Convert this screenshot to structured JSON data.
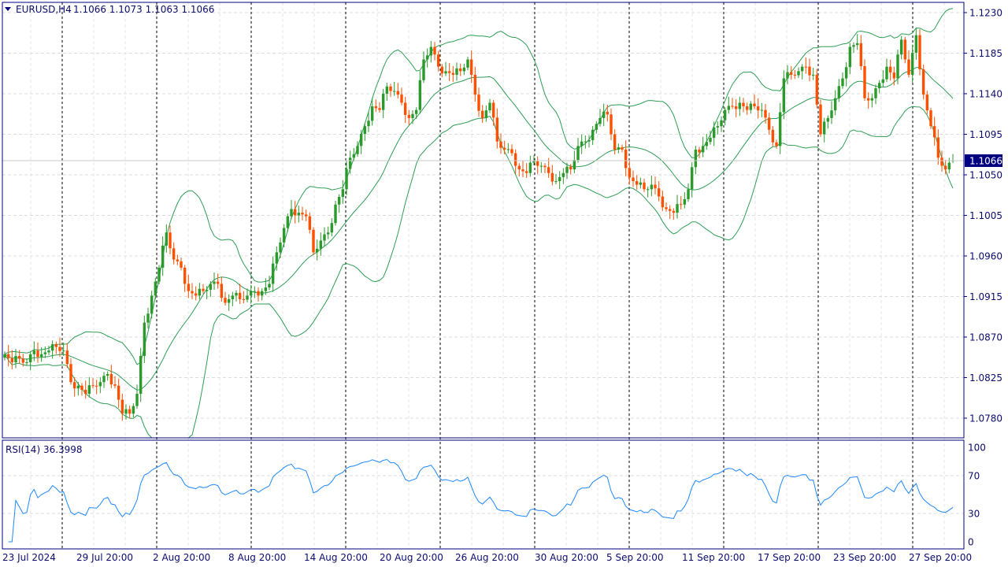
{
  "header": {
    "symbol": "EURUSD,H4",
    "ohlc": "1.1066 1.1073 1.1063 1.1066"
  },
  "rsi_panel": {
    "label": "RSI(14) 36.3998"
  },
  "current_price_label": "1.1066",
  "colors": {
    "bull": "#2a9a2a",
    "bear": "#ff5000",
    "bands": "#2e9e55",
    "rsi": "#1e88ff",
    "axis": "#000080"
  },
  "chart_data": [
    {
      "type": "candlestick",
      "title": "EURUSD,H4",
      "indicators": [
        "Bollinger Bands (20, 2)"
      ],
      "ylim": [
        1.076,
        1.1245
      ],
      "y_ticks": [
        "1.1230",
        "1.1185",
        "1.1140",
        "1.1095",
        "1.1050",
        "1.1005",
        "1.0960",
        "1.0915",
        "1.0870",
        "1.0825",
        "1.0780"
      ],
      "x_ticks": [
        "23 Jul 2024",
        "29 Jul 20:00",
        "2 Aug 20:00",
        "8 Aug 20:00",
        "14 Aug 20:00",
        "20 Aug 20:00",
        "26 Aug 20:00",
        "30 Aug 20:00",
        "5 Sep 20:00",
        "11 Sep 20:00",
        "17 Sep 20:00",
        "23 Sep 20:00",
        "27 Sep 20:00"
      ],
      "last_candle": {
        "open": 1.1066,
        "high": 1.1073,
        "low": 1.1063,
        "close": 1.1066
      },
      "closes_approx": [
        1.0851,
        1.0842,
        1.0846,
        1.0842,
        1.0855,
        1.0851,
        1.0855,
        1.0859,
        1.0855,
        1.082,
        1.0816,
        1.0807,
        1.0816,
        1.082,
        1.0829,
        1.0816,
        1.0785,
        1.0785,
        1.0807,
        1.0886,
        1.0916,
        1.0947,
        1.0986,
        1.0956,
        1.0947,
        1.0921,
        1.0916,
        1.0921,
        1.0929,
        1.0929,
        1.0908,
        1.0916,
        1.0912,
        1.0916,
        1.0921,
        1.0921,
        1.0929,
        1.0964,
        1.0991,
        1.1012,
        1.1008,
        1.1004,
        1.0964,
        1.0977,
        1.0986,
        1.1017,
        1.1034,
        1.1069,
        1.1082,
        1.1104,
        1.1126,
        1.1122,
        1.1148,
        1.1143,
        1.113,
        1.1113,
        1.1122,
        1.1178,
        1.1192,
        1.117,
        1.1165,
        1.1161,
        1.1165,
        1.1178,
        1.1139,
        1.1113,
        1.113,
        1.1087,
        1.1078,
        1.1074,
        1.1056,
        1.1052,
        1.1065,
        1.106,
        1.1052,
        1.1043,
        1.1052,
        1.1056,
        1.1082,
        1.1087,
        1.11,
        1.1113,
        1.1117,
        1.1078,
        1.1078,
        1.1047,
        1.1039,
        1.1034,
        1.1039,
        1.1026,
        1.1012,
        1.1008,
        1.1017,
        1.1034,
        1.1078,
        1.1082,
        1.1091,
        1.1104,
        1.1122,
        1.1126,
        1.113,
        1.1122,
        1.1126,
        1.1122,
        1.11,
        1.1082,
        1.1157,
        1.1161,
        1.1165,
        1.117,
        1.1161,
        1.1095,
        1.1113,
        1.1135,
        1.1157,
        1.1192,
        1.1196,
        1.1135,
        1.1135,
        1.1152,
        1.117,
        1.1157,
        1.12,
        1.1161,
        1.1205,
        1.1139,
        1.1104,
        1.1069,
        1.1056,
        1.1066
      ]
    },
    {
      "type": "line",
      "title": "RSI(14) 36.3998",
      "ylim": [
        0,
        100
      ],
      "y_ticks": [
        "100",
        "70",
        "30",
        "0"
      ],
      "last_value": 36.3998
    }
  ]
}
